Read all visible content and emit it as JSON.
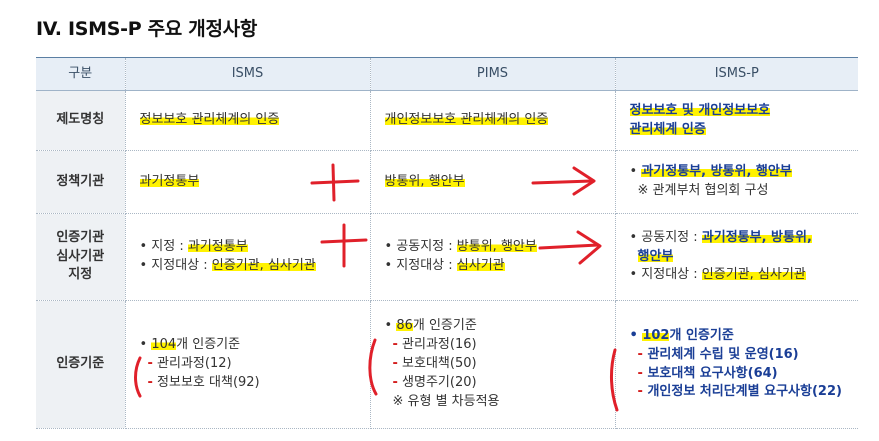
{
  "title": "IV. ISMS-P 주요 개정사항",
  "headers": [
    "구분",
    "ISMS",
    "PIMS",
    "ISMS-P"
  ],
  "rows": {
    "name": {
      "label": "제도명칭",
      "isms": "정보보호 관리체계의 인증",
      "pims": "개인정보보호 관리체계의 인증",
      "ismsp_line1": "정보보호 및 개인정보보호",
      "ismsp_line2": "관리체계 인증"
    },
    "policy": {
      "label": "정책기관",
      "isms": "과기정통부",
      "pims": "방통위, 행안부",
      "ismsp_bullet": "•",
      "ismsp_line1": "과기정통부, 방통위, 행안부",
      "ismsp_note": "※ 관계부처 협의회 구성"
    },
    "cert": {
      "label1": "인증기관",
      "label2": "심사기관",
      "label3": "지정",
      "isms_line1_prefix": "• 지정 : ",
      "isms_line1_value": "과기정통부",
      "isms_line2_prefix": "• 지정대상 : ",
      "isms_line2_value": "인증기관, 심사기관",
      "pims_line1_prefix": "• 공동지정 : ",
      "pims_line1_value": "방통위, 행안부",
      "pims_line2_prefix": "• 지정대상 : ",
      "pims_line2_value": "심사기관",
      "ismsp_line1_prefix": "• 공동지정 : ",
      "ismsp_line1_value": "과기정통부, 방통위,",
      "ismsp_line1_cont": "행안부",
      "ismsp_line2_prefix": "• 지정대상 : ",
      "ismsp_line2_value": "인증기관, 심사기관"
    },
    "criteria": {
      "label": "인증기준",
      "isms_count": "104",
      "isms_count_suffix": "개 인증기준",
      "isms_item1": "관리과정(12)",
      "isms_item2": "정보보호 대책(92)",
      "pims_count": "86",
      "pims_count_suffix": "개 인증기준",
      "pims_item1": "관리과정(16)",
      "pims_item2": "보호대책(50)",
      "pims_item3": "생명주기(20)",
      "pims_note": "※ 유형 별 차등적용",
      "ismsp_count": "102",
      "ismsp_count_suffix": "개 인증기준",
      "ismsp_item1": "관리체계 수립 및 운영(16)",
      "ismsp_item2": "보호대책 요구사항(64)",
      "ismsp_item3": "개인정보 처리단계별 요구사항(22)"
    }
  },
  "colors": {
    "highlight": "#fff200",
    "annotation": "#e0202a",
    "header_bg": "#e7eef6",
    "emphasis": "#1a3e96"
  }
}
